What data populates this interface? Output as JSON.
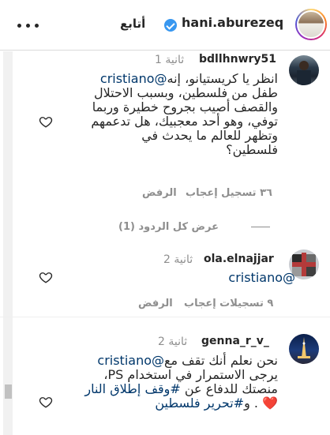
{
  "header": {
    "username": "hani.aburezeq",
    "follow_label": "أتابع",
    "more_icon": "more-icon",
    "verified_icon": "verified-badge-icon"
  },
  "comments": [
    {
      "username": "bdllhnwry51",
      "time": "1 ثانية",
      "line1_prefix": "انظر يا كريستيانو، إنه",
      "mention": "@cristiano",
      "lines": [
        "طفل من فلسطين، وبسبب الاحتلال",
        "والقصف أصيب بجروح خطيرة وربما",
        "توفي، وهو أحد معجبيك، هل تدعمهم",
        "وتظهر للعالم ما يحدث في",
        "فلسطين؟"
      ],
      "likes": "٣٦ تسجيل إعجاب",
      "reject": "الرفض"
    },
    {
      "username": "ola.elnajjar",
      "time": "2 ثانية",
      "mention": "@cristiano",
      "likes": "٩ تسجيلات إعجاب",
      "reject": "الرفض"
    },
    {
      "username": "genna_r_v_",
      "time": "2 ثانية",
      "line1_prefix": "نحن نعلم أنك تقف مع",
      "mention": "@cristiano",
      "line2": "يرجى الاستمرار في استخدام PS،",
      "line3_prefix": "منصتك للدفاع عن",
      "hashtag1": "#وقف إطلاق النار",
      "line4_prefix": ". و",
      "hashtag2": "#تحرير فلسطين",
      "emoji": "❤️"
    }
  ],
  "view_replies": "عرض كل الردود (1)",
  "colors": {
    "mention": "#00376b",
    "secondary": "#8e8e8e",
    "verified": "#3897f0",
    "heart_emoji": "#ed2939"
  }
}
